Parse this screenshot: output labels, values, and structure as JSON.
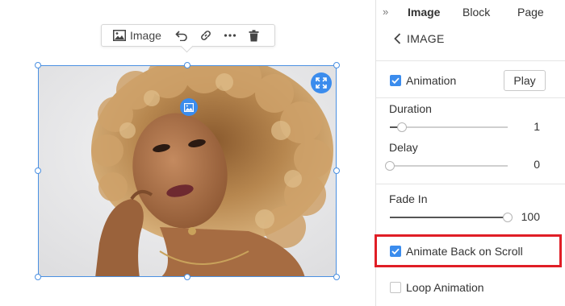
{
  "toolbar": {
    "type_label": "Image",
    "type_icon": "image-icon",
    "actions": [
      "undo-icon",
      "link-icon",
      "more-icon",
      "trash-icon"
    ]
  },
  "canvas": {
    "selection_color": "#4a90e2",
    "badge_color": "#3b8ced"
  },
  "panel": {
    "collapse_glyph": "»",
    "tabs": [
      {
        "label": "Image",
        "active": true
      },
      {
        "label": "Block",
        "active": false
      },
      {
        "label": "Page",
        "active": false
      }
    ],
    "back_label": "IMAGE",
    "animation": {
      "label": "Animation",
      "checked": true,
      "play_label": "Play"
    },
    "duration": {
      "label": "Duration",
      "value_text": "1",
      "fraction": 0.1
    },
    "delay": {
      "label": "Delay",
      "value_text": "0",
      "fraction": 0.0
    },
    "fade_in": {
      "label": "Fade In",
      "value_text": "100",
      "fraction": 1.0
    },
    "animate_back": {
      "label": "Animate Back on Scroll",
      "checked": true
    },
    "loop": {
      "label": "Loop Animation",
      "checked": false
    },
    "highlight_color": "#e01e26",
    "accent_color": "#3b8ced"
  }
}
